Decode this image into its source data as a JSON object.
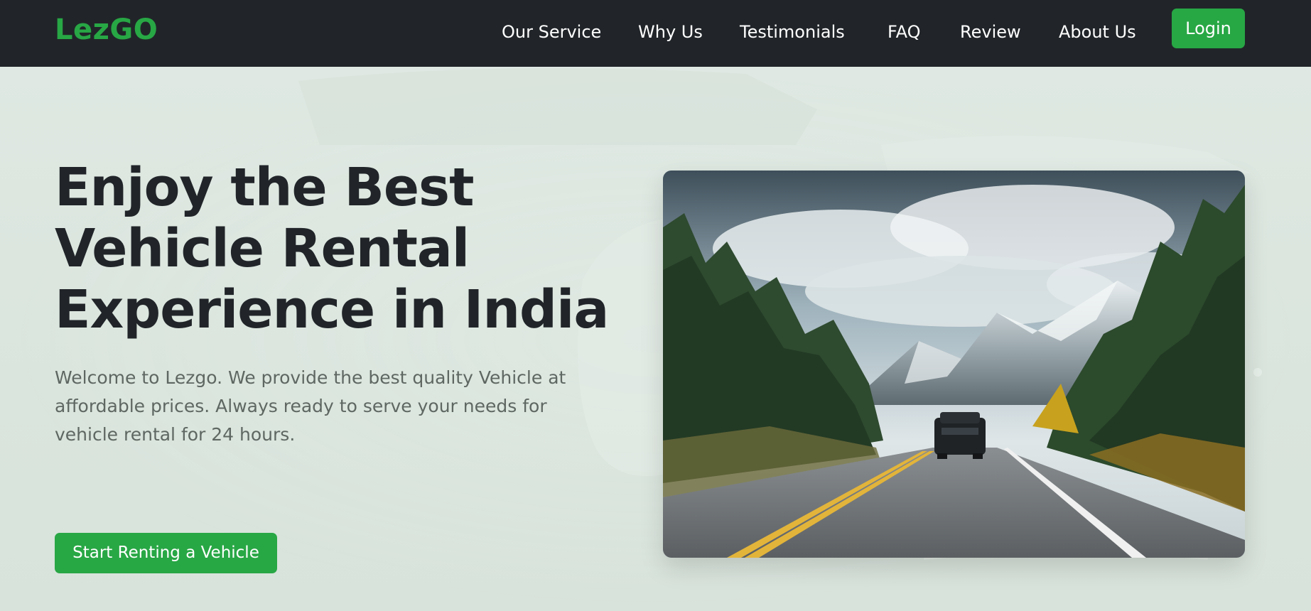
{
  "brand": {
    "name": "LezGO",
    "color": "#28a745"
  },
  "nav": {
    "links": [
      "Our Service",
      "Why Us",
      "Testimonials",
      "FAQ",
      "Review",
      "About Us"
    ],
    "login_label": "Login"
  },
  "hero": {
    "title": "Enjoy the Best Vehicle Rental Experience in India",
    "description": "Welcome to Lezgo. We provide the best quality Vehicle at affordable prices. Always ready to serve your needs for vehicle rental for 24 hours.",
    "cta_label": "Start Renting a Vehicle",
    "image_subject": "car-on-mountain-road-photo"
  },
  "colors": {
    "navbar_bg": "#212529",
    "accent": "#28a745",
    "hero_bg": "#dbe6df",
    "title_text": "#212529",
    "body_text": "#5f6762"
  }
}
